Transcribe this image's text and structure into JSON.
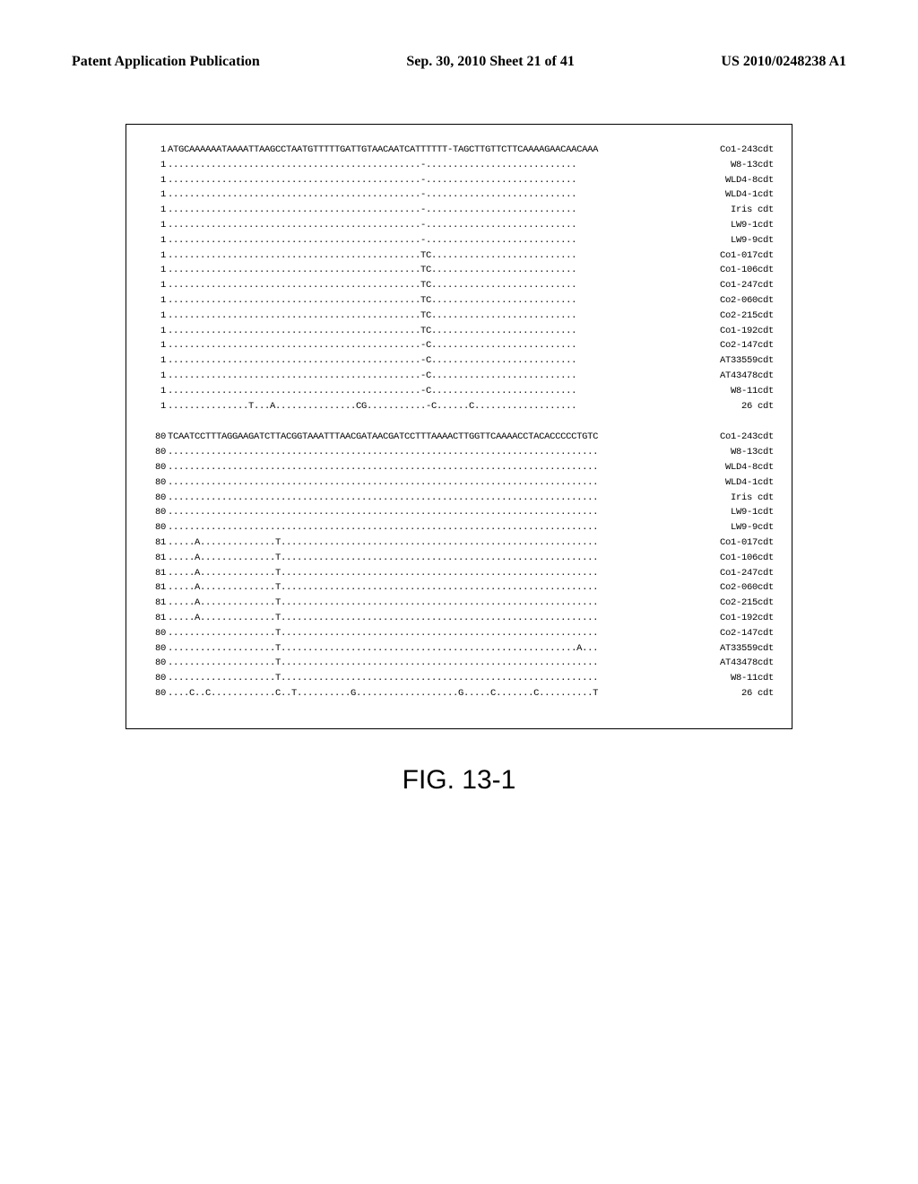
{
  "header": {
    "left": "Patent Application Publication",
    "center": "Sep. 30, 2010  Sheet 21 of 41",
    "right": "US 2010/0248238 A1"
  },
  "alignment": {
    "block1": {
      "ref_pos": "1",
      "ref_seq": "ATGCAAAAAATAAAATTAAGCCTAATGTTTTTGATTGTAACAATCATTTTTT-TAGCTTGTTCTTCAAAAGAACAACAAA",
      "ref_label": "Co1-243cdt",
      "rows": [
        {
          "pos": "1",
          "seq": "...............................................-............................",
          "label": "W8-13cdt"
        },
        {
          "pos": "1",
          "seq": "...............................................-............................",
          "label": "WLD4-8cdt"
        },
        {
          "pos": "1",
          "seq": "...............................................-............................",
          "label": "WLD4-1cdt"
        },
        {
          "pos": "1",
          "seq": "...............................................-............................",
          "label": "Iris cdt"
        },
        {
          "pos": "1",
          "seq": "...............................................-............................",
          "label": "LW9-1cdt"
        },
        {
          "pos": "1",
          "seq": "...............................................-............................",
          "label": "LW9-9cdt"
        },
        {
          "pos": "1",
          "seq": "...............................................TC...........................",
          "label": "Co1-017cdt"
        },
        {
          "pos": "1",
          "seq": "...............................................TC...........................",
          "label": "Co1-106cdt"
        },
        {
          "pos": "1",
          "seq": "...............................................TC...........................",
          "label": "Co1-247cdt"
        },
        {
          "pos": "1",
          "seq": "...............................................TC...........................",
          "label": "Co2-060cdt"
        },
        {
          "pos": "1",
          "seq": "...............................................TC...........................",
          "label": "Co2-215cdt"
        },
        {
          "pos": "1",
          "seq": "...............................................TC...........................",
          "label": "Co1-192cdt"
        },
        {
          "pos": "1",
          "seq": "...............................................-C...........................",
          "label": "Co2-147cdt"
        },
        {
          "pos": "1",
          "seq": "...............................................-C...........................",
          "label": "AT33559cdt"
        },
        {
          "pos": "1",
          "seq": "...............................................-C...........................",
          "label": "AT43478cdt"
        },
        {
          "pos": "1",
          "seq": "...............................................-C...........................",
          "label": "W8-11cdt"
        },
        {
          "pos": "1",
          "seq": "...............T...A...............CG...........-C......C...................",
          "label": "26 cdt"
        }
      ]
    },
    "block2": {
      "ref_pos": "80",
      "ref_seq": "TCAATCCTTTAGGAAGATCTTACGGTAAATTTAACGATAACGATCCTTTAAAACTTGGTTCAAAACCTACACCCCCTGTC",
      "ref_label": "Co1-243cdt",
      "rows": [
        {
          "pos": "80",
          "seq": "................................................................................",
          "label": "W8-13cdt"
        },
        {
          "pos": "80",
          "seq": "................................................................................",
          "label": "WLD4-8cdt"
        },
        {
          "pos": "80",
          "seq": "................................................................................",
          "label": "WLD4-1cdt"
        },
        {
          "pos": "80",
          "seq": "................................................................................",
          "label": "Iris cdt"
        },
        {
          "pos": "80",
          "seq": "................................................................................",
          "label": "LW9-1cdt"
        },
        {
          "pos": "80",
          "seq": "................................................................................",
          "label": "LW9-9cdt"
        },
        {
          "pos": "81",
          "seq": ".....A..............T...........................................................",
          "label": "Co1-017cdt"
        },
        {
          "pos": "81",
          "seq": ".....A..............T...........................................................",
          "label": "Co1-106cdt"
        },
        {
          "pos": "81",
          "seq": ".....A..............T...........................................................",
          "label": "Co1-247cdt"
        },
        {
          "pos": "81",
          "seq": ".....A..............T...........................................................",
          "label": "Co2-060cdt"
        },
        {
          "pos": "81",
          "seq": ".....A..............T...........................................................",
          "label": "Co2-215cdt"
        },
        {
          "pos": "81",
          "seq": ".....A..............T...........................................................",
          "label": "Co1-192cdt"
        },
        {
          "pos": "80",
          "seq": "....................T...........................................................",
          "label": "Co2-147cdt"
        },
        {
          "pos": "80",
          "seq": "....................T.......................................................A...",
          "label": "AT33559cdt"
        },
        {
          "pos": "80",
          "seq": "....................T...........................................................",
          "label": "AT43478cdt"
        },
        {
          "pos": "80",
          "seq": "....................T...........................................................",
          "label": "W8-11cdt"
        },
        {
          "pos": "80",
          "seq": "....C..C............C..T..........G...................G.....C.......C..........T",
          "label": "26 cdt"
        }
      ]
    }
  },
  "caption": "FIG. 13-1"
}
